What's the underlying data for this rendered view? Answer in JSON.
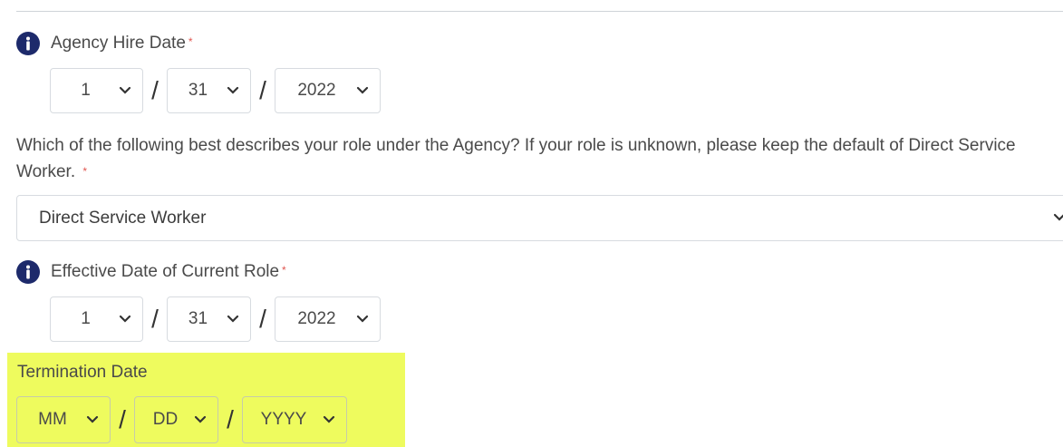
{
  "agency_hire_date": {
    "label": "Agency Hire Date",
    "required_mark": "*",
    "month": "1",
    "day": "31",
    "year": "2022",
    "separator": "/"
  },
  "role_question": {
    "text": "Which of the following best describes your role under the Agency? If your role is unknown, please keep the default of Direct Service Worker.",
    "required_mark": "*",
    "selected": "Direct Service Worker"
  },
  "effective_date": {
    "label": "Effective Date of Current Role",
    "required_mark": "*",
    "month": "1",
    "day": "31",
    "year": "2022",
    "separator": "/"
  },
  "termination_date": {
    "label": "Termination Date",
    "month_placeholder": "MM",
    "day_placeholder": "DD",
    "year_placeholder": "YYYY",
    "separator": "/"
  },
  "colors": {
    "highlight": "#eefb5e",
    "required": "#e0554f",
    "info_icon": "#1d2a6b"
  }
}
